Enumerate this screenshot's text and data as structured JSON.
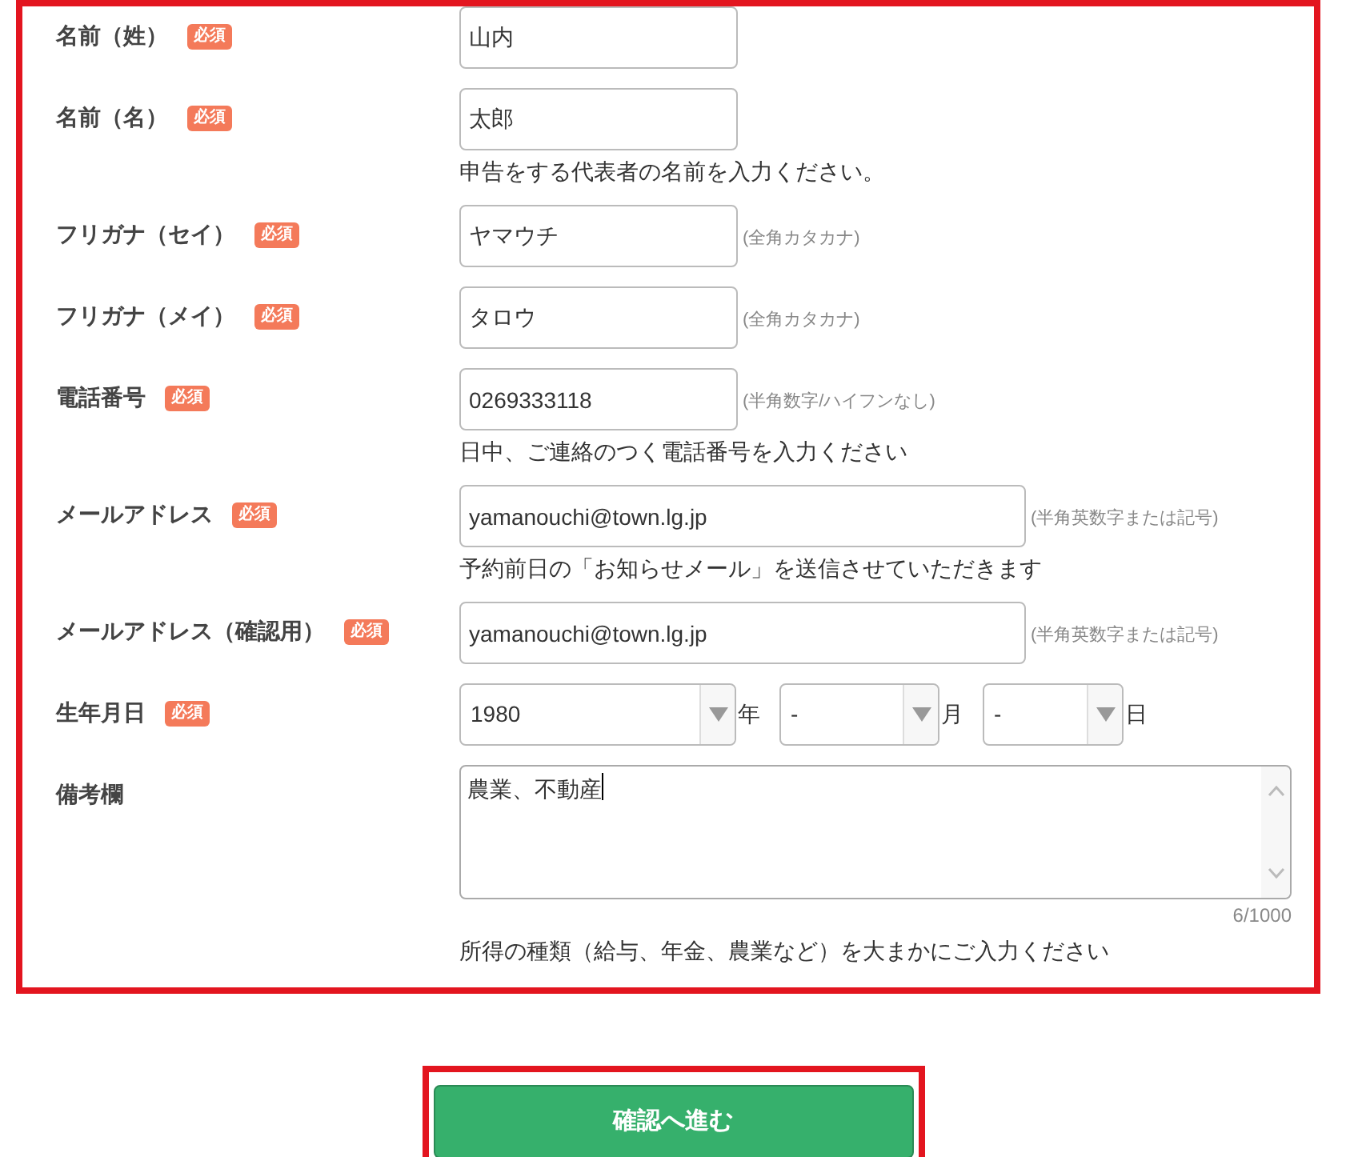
{
  "form": {
    "rows": [
      {
        "kind": "text",
        "label": "名前（姓）",
        "required": true,
        "badge": "必須",
        "value": "山内"
      },
      {
        "kind": "text",
        "label": "名前（名）",
        "required": true,
        "badge": "必須",
        "value": "太郎",
        "note": "申告をする代表者の名前を入力ください。"
      },
      {
        "kind": "text",
        "label": "フリガナ（セイ）",
        "required": true,
        "badge": "必須",
        "value": "ヤマウチ",
        "hint": "(全角カタカナ)"
      },
      {
        "kind": "text",
        "label": "フリガナ（メイ）",
        "required": true,
        "badge": "必須",
        "value": "タロウ",
        "hint": "(全角カタカナ)"
      },
      {
        "kind": "text",
        "label": "電話番号",
        "required": true,
        "badge": "必須",
        "value": "0269333118",
        "hint": "(半角数字/ハイフンなし)",
        "note": "日中、ご連絡のつく電話番号を入力ください"
      },
      {
        "kind": "email",
        "label": "メールアドレス",
        "required": true,
        "badge": "必須",
        "value": "yamanouchi@town.lg.jp",
        "hint": "(半角英数字または記号)",
        "note": "予約前日の「お知らせメール」を送信させていただきます"
      },
      {
        "kind": "email",
        "label": "メールアドレス（確認用）",
        "required": true,
        "badge": "必須",
        "value": "yamanouchi@town.lg.jp",
        "hint": "(半角英数字または記号)"
      },
      {
        "kind": "date",
        "label": "生年月日",
        "required": true,
        "badge": "必須",
        "selects": [
          {
            "value": "1980",
            "unit": "年"
          },
          {
            "value": "-",
            "unit": "月"
          },
          {
            "value": "-",
            "unit": "日"
          }
        ]
      },
      {
        "kind": "textarea",
        "label": "備考欄",
        "required": false,
        "value": "農業、不動産",
        "focused": true,
        "counter": "6/1000",
        "note": "所得の種類（給与、年金、農業など）を大まかにご入力ください"
      }
    ]
  },
  "submit": {
    "label": "確認へ進む"
  }
}
